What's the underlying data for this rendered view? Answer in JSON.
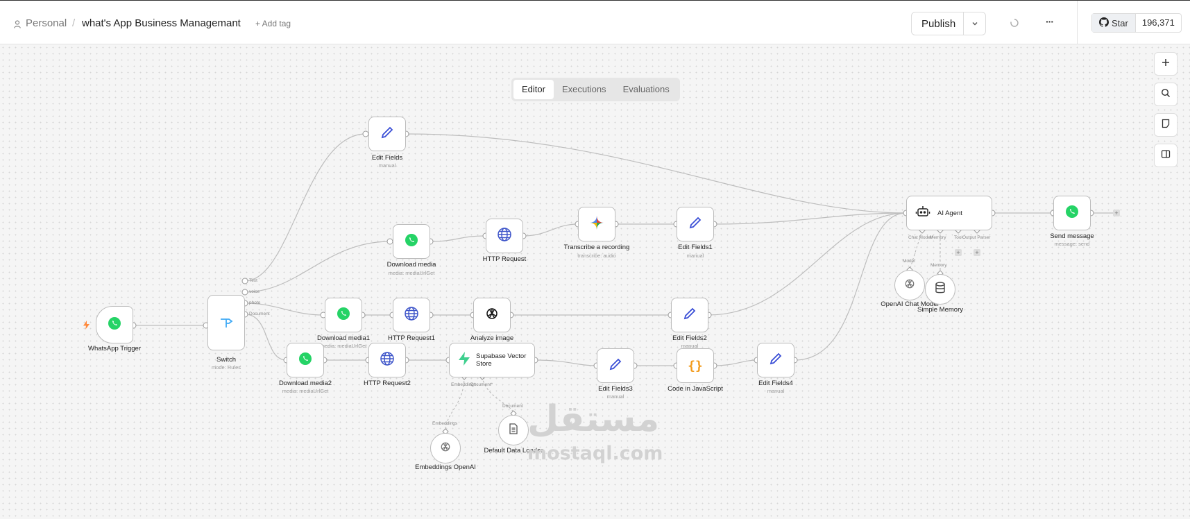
{
  "header": {
    "breadcrumb_root": "Personal",
    "separator": "/",
    "workflow_name": "what's App Business Managemant",
    "add_tag": "+ Add tag",
    "publish": "Publish",
    "more": "···",
    "github": {
      "star": "Star",
      "count": "196,371"
    }
  },
  "tabs": [
    "Editor",
    "Executions",
    "Evaluations"
  ],
  "nodes": {
    "trigger": {
      "label": "WhatsApp Trigger",
      "icon": "whatsapp-icon"
    },
    "switch": {
      "label": "Switch",
      "sub": "mode: Rules",
      "outputs": [
        "Text",
        "voice",
        "photo",
        "Document"
      ]
    },
    "edit_fields": {
      "label": "Edit Fields",
      "sub": "manual"
    },
    "download_media": {
      "label": "Download media",
      "sub": "media: mediaUrlGet"
    },
    "http_request": {
      "label": "HTTP Request"
    },
    "transcribe": {
      "label": "Transcribe a recording",
      "sub": "transcribe: audio"
    },
    "edit_fields1": {
      "label": "Edit Fields1",
      "sub": "manual"
    },
    "download_media1": {
      "label": "Download media1",
      "sub": "media: mediaUrlGet"
    },
    "http_request1": {
      "label": "HTTP Request1"
    },
    "analyze_image": {
      "label": "Analyze image"
    },
    "edit_fields2": {
      "label": "Edit Fields2",
      "sub": "manual"
    },
    "download_media2": {
      "label": "Download media2",
      "sub": "media: mediaUrlGet"
    },
    "http_request2": {
      "label": "HTTP Request2"
    },
    "supabase": {
      "label": "Supabase Vector Store",
      "port_embedding": "Embedding*",
      "port_document": "Document*"
    },
    "edit_fields3": {
      "label": "Edit Fields3",
      "sub": "manual"
    },
    "code_js": {
      "label": "Code in JavaScript"
    },
    "edit_fields4": {
      "label": "Edit Fields4",
      "sub": "manual"
    },
    "ai_agent": {
      "label": "AI Agent",
      "ports": [
        "Chat Model*",
        "Memory",
        "Tool",
        "Output Parser"
      ]
    },
    "send_message": {
      "label": "Send message",
      "sub": "message: send"
    },
    "openai_chat": {
      "label": "OpenAI Chat Model",
      "edge_label": "Model"
    },
    "simple_memory": {
      "label": "Simple Memory",
      "edge_label": "Memory"
    },
    "embeddings": {
      "label": "Embeddings OpenAI",
      "edge_label": "Embeddings"
    },
    "data_loader": {
      "label": "Default Data Loader",
      "edge_label": "Document"
    }
  },
  "watermark": {
    "arabic": "مستقل",
    "latin": "mostaql.com"
  },
  "colors": {
    "accent": "#ff6d5a",
    "whatsapp": "#25d366",
    "edit_blue": "#3b4fd6",
    "http_blue": "#3d54c9",
    "supabase": "#3ecf8e",
    "code_orange": "#f29a1a"
  }
}
